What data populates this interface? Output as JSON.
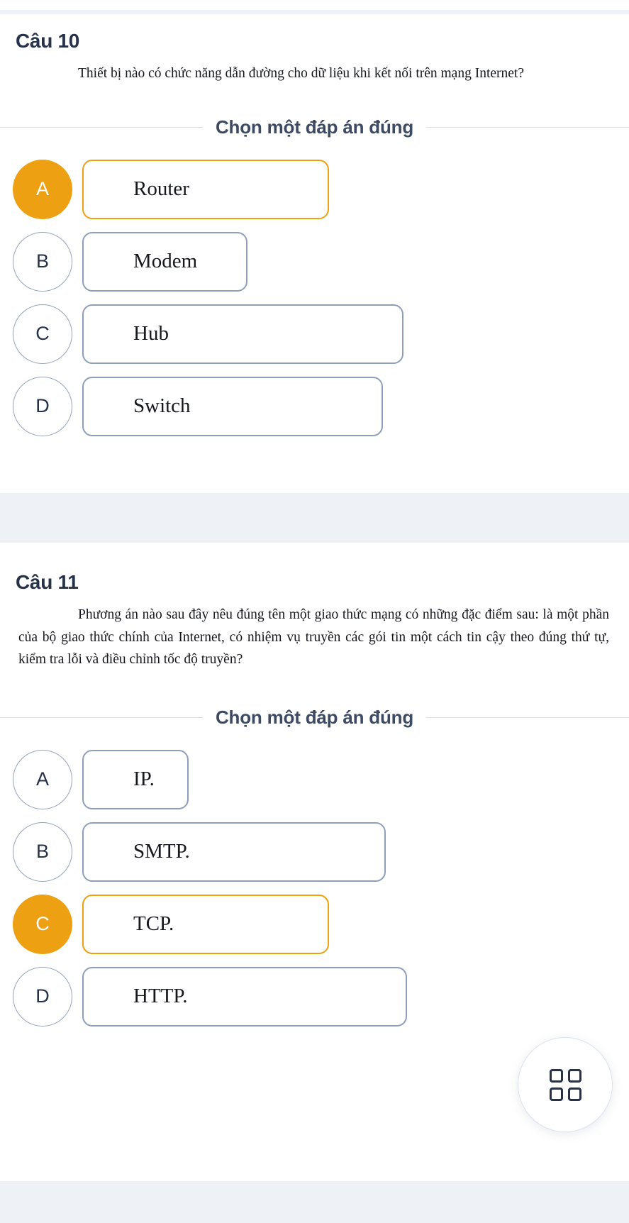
{
  "theme": {
    "accent": "#eda012",
    "text_dark": "#26324a",
    "border_idle": "#8e9fba",
    "page_bg": "#eef1f6",
    "card_bg": "#ffffff"
  },
  "questions": [
    {
      "number_label": "Câu 10",
      "prompt": "Thiết bị nào có chức năng dẫn đường cho dữ liệu khi kết nối trên mạng Internet?",
      "instruction": "Chọn một đáp án đúng",
      "options": [
        {
          "letter": "A",
          "text": "Router",
          "selected": true
        },
        {
          "letter": "B",
          "text": "Modem",
          "selected": false
        },
        {
          "letter": "C",
          "text": "Hub",
          "selected": false
        },
        {
          "letter": "D",
          "text": "Switch",
          "selected": false
        }
      ]
    },
    {
      "number_label": "Câu 11",
      "prompt": "Phương án nào sau đây nêu đúng tên một giao thức mạng có những đặc điểm sau: là một phần của bộ giao thức chính của Internet, có nhiệm vụ truyền các gói tin một cách tin cậy theo đúng thứ tự, kiểm tra lỗi và điều chỉnh tốc độ truyền?",
      "instruction": "Chọn một đáp án đúng",
      "options": [
        {
          "letter": "A",
          "text": "IP.",
          "selected": false
        },
        {
          "letter": "B",
          "text": "SMTP.",
          "selected": false
        },
        {
          "letter": "C",
          "text": "TCP.",
          "selected": true
        },
        {
          "letter": "D",
          "text": "HTTP.",
          "selected": false
        }
      ]
    }
  ],
  "fab": {
    "icon": "grid-2x2-icon"
  }
}
